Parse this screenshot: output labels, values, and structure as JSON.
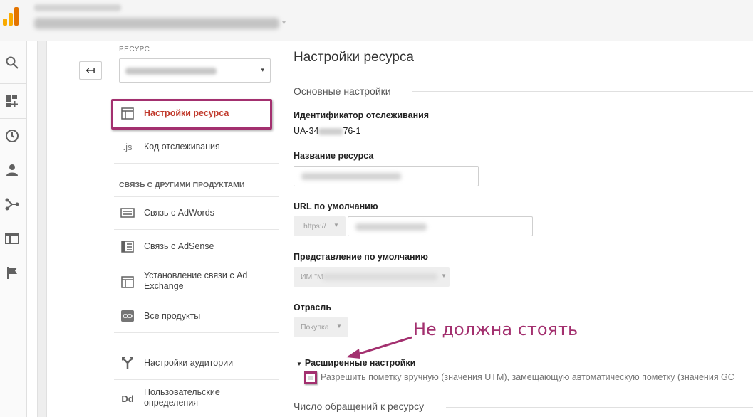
{
  "header": {
    "logo_icon": "analytics-bars-icon",
    "account_caret": "▾"
  },
  "nav": {
    "icons": [
      "search-icon",
      "dashboard-add-icon",
      "clock-icon",
      "person-icon",
      "acquisition-icon",
      "behavior-icon",
      "flag-icon"
    ]
  },
  "back_button": {
    "glyph": "↤"
  },
  "resource": {
    "label": "РЕСУРС",
    "caret": "▾"
  },
  "menu": {
    "resource_settings": "Настройки ресурса",
    "tracking_code_icon": ".js",
    "tracking_code": "Код отслеживания",
    "section_links": "СВЯЗЬ С ДРУГИМИ ПРОДУКТАМИ",
    "adwords": "Связь с AdWords",
    "adsense": "Связь с AdSense",
    "adexchange": "Установление связи с Ad Exchange",
    "all_products": "Все продукты",
    "audience": "Настройки аудитории",
    "custom_defs_icon": "Dd",
    "custom_defs": "Пользовательские определения"
  },
  "main": {
    "title": "Настройки ресурса",
    "basic_section": "Основные настройки",
    "tracking_id_label": "Идентификатор отслеживания",
    "tracking_id_prefix": "UA-34",
    "tracking_id_suffix": "76-1",
    "name_label": "Название ресурса",
    "url_label": "URL по умолчанию",
    "url_scheme": "https://",
    "view_label": "Представление по умолчанию",
    "view_value": "ИМ \"М",
    "industry_label": "Отрасль",
    "industry_value": "Покупка",
    "annotation": "Не должна стоять",
    "advanced_label": "Расширенные настройки",
    "manual_tagging": "Разрешить пометку вручную (значения UTM), замещающую автоматическую пометку (значения GC",
    "hits_section": "Число обращений к ресурсу"
  },
  "colors": {
    "highlight": "#a3306f",
    "active_text": "#c0392b"
  }
}
